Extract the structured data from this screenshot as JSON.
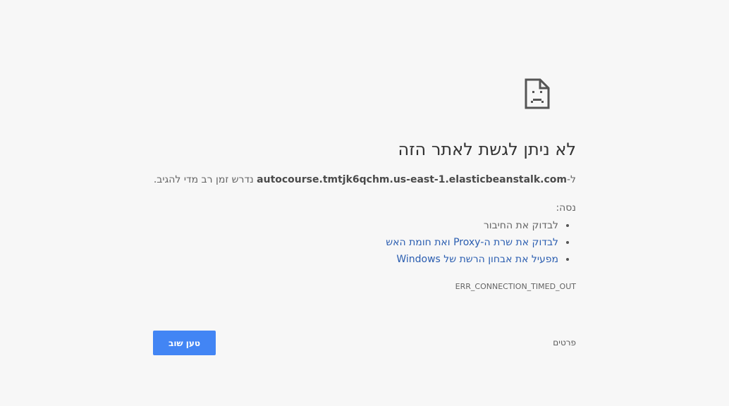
{
  "icon": "sad-page-icon",
  "title": "לא ניתן לגשת לאתר הזה",
  "summary": {
    "prefix": "ל-",
    "host": "autocourse.tmtjk6qchm.us-east-1.elasticbeanstalk.com",
    "suffix": " נדרש זמן רב מדי להגיב."
  },
  "try_label": "נסה:",
  "suggestions": [
    "לבדוק את החיבור",
    "לבדוק את שרת ה-Proxy ואת חומת האש",
    "מפעיל את אבחון הרשת של Windows"
  ],
  "error_code": "ERR_CONNECTION_TIMED_OUT",
  "details_label": "פרטים",
  "reload_label": "טען שוב",
  "colors": {
    "background": "#f7f7f7",
    "accent": "#4285f4",
    "link": "#2a5db0",
    "text": "#646464"
  }
}
